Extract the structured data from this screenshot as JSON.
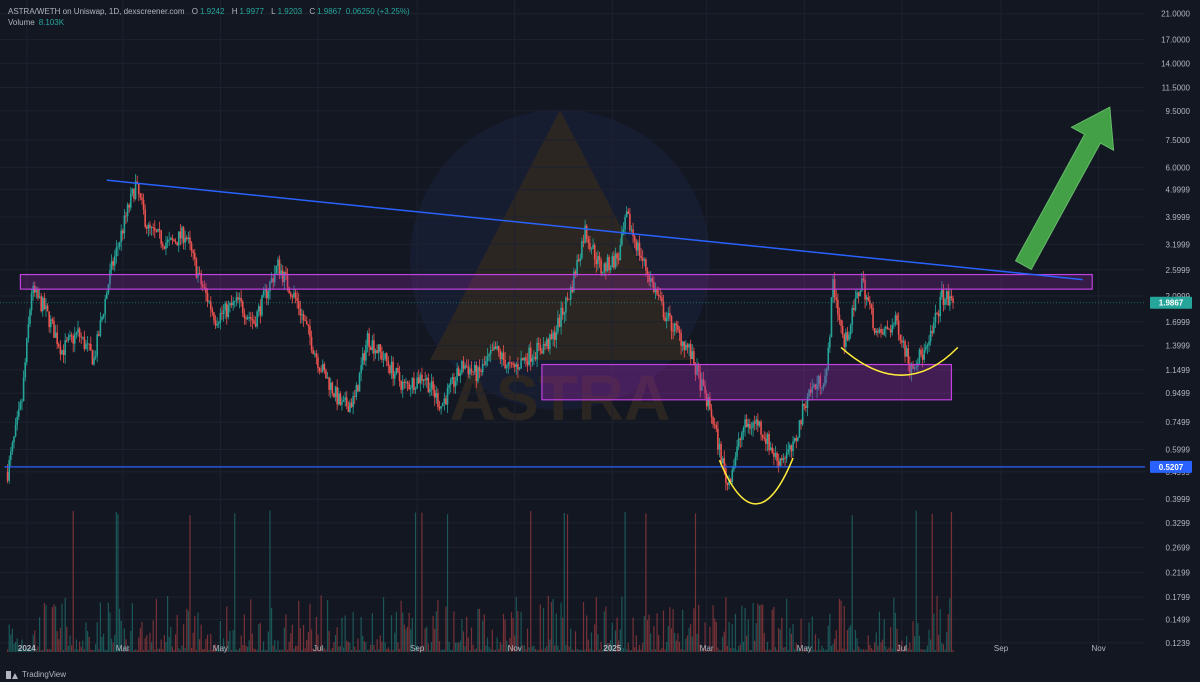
{
  "header": {
    "symbol": "ASTRA/WETH on Uniswap, 1D, dexscreener.com",
    "o_label": "O",
    "o_value": "1.9242",
    "h_label": "H",
    "h_value": "1.9977",
    "l_label": "L",
    "l_value": "1.9203",
    "c_label": "C",
    "c_value": "1.9867",
    "change": "0.06250 (+3.25%)",
    "volume_label": "Volume",
    "volume_value": "8.103K"
  },
  "footer": {
    "brand": "TradingView",
    "brand_icon": "tradingview-logo-icon"
  },
  "watermark": {
    "text": "ASTRA"
  },
  "colors": {
    "background": "#131722",
    "up": "#26a69a",
    "down": "#ef5350",
    "trendline": "#2962ff",
    "zone": "#9c27b0",
    "support": "#2962ff",
    "curve": "#ffeb3b",
    "arrow": "#43a047",
    "price_badge": "#26a69a"
  },
  "chart_data": {
    "type": "candlestick",
    "scale": "log",
    "x": [
      "2024",
      "Mar",
      "May",
      "Jul",
      "Sep",
      "Nov",
      "2025",
      "Mar",
      "May",
      "Jul",
      "Sep",
      "Nov"
    ],
    "x_range": [
      "2023-12-19",
      "2025-11-30"
    ],
    "y_ticks": [
      "21.0000",
      "17.0000",
      "14.0000",
      "11.5000",
      "9.5000",
      "7.5000",
      "6.0000",
      "4.9999",
      "3.9999",
      "3.1999",
      "2.5999",
      "2.0999",
      "1.6999",
      "1.3999",
      "1.1499",
      "0.9499",
      "0.7499",
      "0.5999",
      "0.4999",
      "0.3999",
      "0.3299",
      "0.2699",
      "0.2199",
      "0.1799",
      "0.1499",
      "0.1239"
    ],
    "ylim": [
      0.115,
      22
    ],
    "last_price": "1.9867",
    "support_price": "0.5207",
    "anchors": [
      [
        "2023-12-20",
        0.5
      ],
      [
        "2023-12-29",
        0.9
      ],
      [
        "2024-01-04",
        2.2
      ],
      [
        "2024-01-12",
        1.9
      ],
      [
        "2024-01-23",
        1.35
      ],
      [
        "2024-02-02",
        1.55
      ],
      [
        "2024-02-12",
        1.25
      ],
      [
        "2024-02-22",
        2.5
      ],
      [
        "2024-03-04",
        4.2
      ],
      [
        "2024-03-09",
        5.2
      ],
      [
        "2024-03-17",
        3.6
      ],
      [
        "2024-03-30",
        3.2
      ],
      [
        "2024-04-09",
        3.5
      ],
      [
        "2024-04-18",
        2.4
      ],
      [
        "2024-04-28",
        1.75
      ],
      [
        "2024-05-12",
        2.0
      ],
      [
        "2024-05-22",
        1.7
      ],
      [
        "2024-06-06",
        2.7
      ],
      [
        "2024-06-18",
        2.0
      ],
      [
        "2024-07-02",
        1.2
      ],
      [
        "2024-07-16",
        0.85
      ],
      [
        "2024-07-24",
        0.9
      ],
      [
        "2024-08-01",
        1.5
      ],
      [
        "2024-08-12",
        1.25
      ],
      [
        "2024-08-24",
        1.0
      ],
      [
        "2024-09-05",
        1.1
      ],
      [
        "2024-09-16",
        0.86
      ],
      [
        "2024-09-30",
        1.2
      ],
      [
        "2024-10-09",
        1.1
      ],
      [
        "2024-10-20",
        1.35
      ],
      [
        "2024-10-30",
        1.15
      ],
      [
        "2024-11-10",
        1.3
      ],
      [
        "2024-11-24",
        1.45
      ],
      [
        "2024-12-06",
        2.2
      ],
      [
        "2024-12-15",
        3.6
      ],
      [
        "2024-12-25",
        2.6
      ],
      [
        "2025-01-05",
        2.9
      ],
      [
        "2025-01-10",
        4.0
      ],
      [
        "2025-01-20",
        2.8
      ],
      [
        "2025-02-03",
        1.8
      ],
      [
        "2025-02-18",
        1.35
      ],
      [
        "2025-03-04",
        0.8
      ],
      [
        "2025-03-14",
        0.45
      ],
      [
        "2025-03-24",
        0.72
      ],
      [
        "2025-04-02",
        0.75
      ],
      [
        "2025-04-14",
        0.55
      ],
      [
        "2025-04-24",
        0.6
      ],
      [
        "2025-05-03",
        0.95
      ],
      [
        "2025-05-15",
        1.1
      ],
      [
        "2025-05-19",
        2.35
      ],
      [
        "2025-05-26",
        1.4
      ],
      [
        "2025-06-06",
        2.4
      ],
      [
        "2025-06-16",
        1.5
      ],
      [
        "2025-06-28",
        1.7
      ],
      [
        "2025-07-06",
        1.2
      ],
      [
        "2025-07-17",
        1.35
      ],
      [
        "2025-07-26",
        2.1
      ],
      [
        "2025-08-02",
        1.9867
      ]
    ],
    "annotations": {
      "trendline": [
        [
          "2024-02-20",
          5.4
        ],
        [
          "2025-10-22",
          2.4
        ]
      ],
      "zone_upper": [
        [
          "2023-12-28",
          2.22
        ],
        [
          "2025-10-28",
          2.5
        ]
      ],
      "zone_middle": [
        [
          "2024-11-18",
          0.9
        ],
        [
          "2025-08-01",
          1.2
        ]
      ],
      "support_line": [
        [
          "2023-12-18",
          0.5207
        ],
        [
          "2025-11-30",
          0.5207
        ]
      ],
      "curve_lower": [
        [
          "2025-03-09",
          0.55
        ],
        [
          "2025-04-01",
          0.37
        ],
        [
          "2025-04-24",
          0.56
        ]
      ],
      "curve_upper": [
        [
          "2025-05-24",
          1.38
        ],
        [
          "2025-07-02",
          1.12
        ],
        [
          "2025-08-05",
          1.38
        ]
      ],
      "arrow": [
        [
          "2025-09-15",
          2.7
        ],
        [
          "2025-11-08",
          9.8
        ]
      ]
    }
  }
}
